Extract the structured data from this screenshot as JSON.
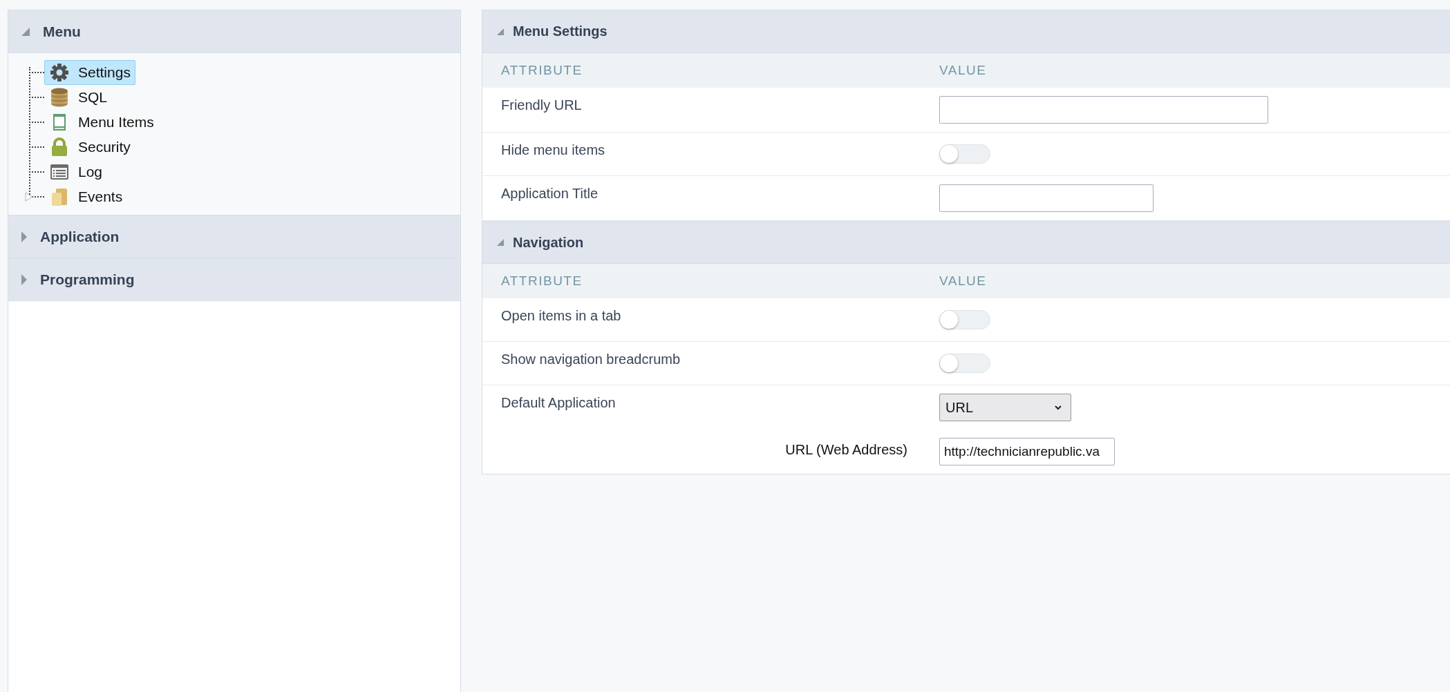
{
  "sidebar": {
    "sections": [
      {
        "title": "Menu",
        "expanded": true,
        "items": [
          {
            "label": "Settings",
            "kind": "gear",
            "selected": true
          },
          {
            "label": "SQL",
            "kind": "database",
            "selected": false
          },
          {
            "label": "Menu Items",
            "kind": "window",
            "selected": false
          },
          {
            "label": "Security",
            "kind": "lock",
            "selected": false
          },
          {
            "label": "Log",
            "kind": "list",
            "selected": false
          },
          {
            "label": "Events",
            "kind": "folder",
            "selected": false,
            "expanded": false
          }
        ]
      },
      {
        "title": "Application",
        "expanded": false
      },
      {
        "title": "Programming",
        "expanded": false
      }
    ]
  },
  "panels": [
    {
      "title": "Menu Settings",
      "expanded": true,
      "columns": [
        "ATTRIBUTE",
        "VALUE"
      ],
      "rows": [
        {
          "kind": "input",
          "label": "Friendly URL",
          "value": ""
        },
        {
          "kind": "toggle",
          "label": "Hide menu items",
          "on": false
        },
        {
          "kind": "input",
          "label": "Application Title",
          "value": ""
        }
      ]
    },
    {
      "title": "Navigation",
      "expanded": true,
      "columns": [
        "ATTRIBUTE",
        "VALUE"
      ],
      "rows": [
        {
          "kind": "toggle",
          "label": "Open items in a tab",
          "on": false
        },
        {
          "kind": "toggle",
          "label": "Show navigation breadcrumb",
          "on": false
        },
        {
          "kind": "select",
          "label": "Default Application",
          "value": "URL"
        },
        {
          "kind": "subinput",
          "label": "URL (Web Address)",
          "value": "http://technicianrepublic.va"
        }
      ]
    }
  ]
}
